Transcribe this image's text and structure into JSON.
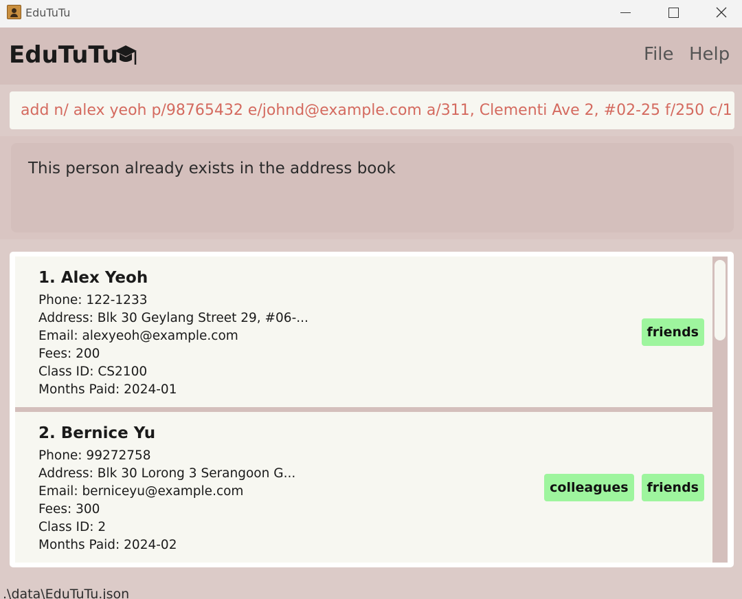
{
  "window": {
    "title": "EduTuTu"
  },
  "header": {
    "brand": "EduTuTu",
    "menu": [
      "File",
      "Help"
    ]
  },
  "command": {
    "value": "add n/ alex  yeoh  p/98765432 e/johnd@example.com a/311, Clementi Ave 2, #02-25 f/250 c/1"
  },
  "result": {
    "message": "This person already exists in the address book"
  },
  "persons": [
    {
      "name": "1. Alex Yeoh",
      "fields": [
        "Phone:  122-1233",
        "Address:  Blk 30 Geylang Street 29, #06-...",
        "Email:  alexyeoh@example.com",
        "Fees:  200",
        "Class ID:  CS2100",
        "Months Paid:  2024-01"
      ],
      "tags": [
        "friends"
      ]
    },
    {
      "name": "2. Bernice Yu",
      "fields": [
        "Phone:  99272758",
        "Address:  Blk 30 Lorong 3 Serangoon G...",
        "Email:  berniceyu@example.com",
        "Fees:  300",
        "Class ID:  2",
        "Months Paid:  2024-02"
      ],
      "tags": [
        "colleagues",
        "friends"
      ]
    }
  ],
  "status": {
    "path": ".\\data\\EduTuTu.json"
  },
  "colors": {
    "accent_bg": "#d4bfbc",
    "card_bg": "#f7f7f1",
    "tag_bg": "#9ef59e",
    "command_text": "#d46a5f"
  },
  "icons": {
    "app": "address-book-icon",
    "brand": "graduation-cap-icon"
  }
}
